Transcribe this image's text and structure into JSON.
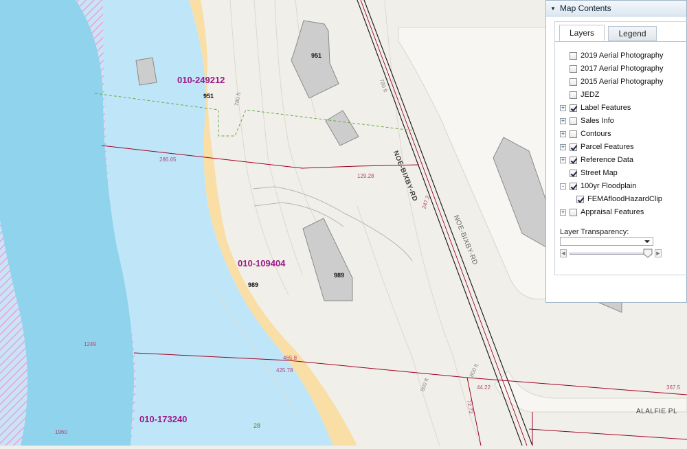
{
  "parcels": [
    {
      "id": "010-249212"
    },
    {
      "id": "010-109404"
    },
    {
      "id": "010-173240"
    }
  ],
  "addresses": [
    "951",
    "951",
    "989",
    "989"
  ],
  "dimensions": [
    "286.65",
    "129.28",
    "247.2",
    "465.8",
    "425.78",
    "44.22",
    "72.73",
    "367.5",
    "1249",
    "1960"
  ],
  "contour_labels": [
    "780 ft",
    "800 ft",
    "800 ft",
    "780 ft"
  ],
  "roads": {
    "main": "NOE-BIXBY-RD",
    "side": "ALALFIE PL"
  },
  "misc_labels": {
    "green_value": "28"
  },
  "panel": {
    "title": "Map Contents",
    "tabs": {
      "layers": "Layers",
      "legend": "Legend"
    },
    "layers": [
      {
        "label": "2019 Aerial Photography",
        "checked": false,
        "expand": false,
        "indent": 1
      },
      {
        "label": "2017 Aerial Photography",
        "checked": false,
        "expand": false,
        "indent": 1
      },
      {
        "label": "2015 Aerial Photography",
        "checked": false,
        "expand": false,
        "indent": 1
      },
      {
        "label": "JEDZ",
        "checked": false,
        "expand": false,
        "indent": 1
      },
      {
        "label": "Label Features",
        "checked": true,
        "expand": "+",
        "indent": 0
      },
      {
        "label": "Sales Info",
        "checked": false,
        "expand": "+",
        "indent": 0
      },
      {
        "label": "Contours",
        "checked": false,
        "expand": "+",
        "indent": 0
      },
      {
        "label": "Parcel Features",
        "checked": true,
        "expand": "+",
        "indent": 0
      },
      {
        "label": "Reference Data",
        "checked": true,
        "expand": "+",
        "indent": 0
      },
      {
        "label": "Street Map",
        "checked": true,
        "expand": false,
        "indent": 1
      },
      {
        "label": "100yr Floodplain",
        "checked": true,
        "expand": "-",
        "indent": 0
      },
      {
        "label": "FEMAfloodHazardClip",
        "checked": true,
        "expand": false,
        "indent": 2
      },
      {
        "label": "Appraisal Features",
        "checked": false,
        "expand": "+",
        "indent": 0
      }
    ],
    "transparency_label": "Layer Transparency:",
    "transparency_value": 0.95
  },
  "colors": {
    "river": "#8fd3ec",
    "water_light": "#bfe6f8",
    "flood_hatch": "#e8a2d8",
    "sand": "#f9dfa5",
    "land": "#f1efe9",
    "building": "#cdcdcd",
    "parcel_line": "#a00020",
    "parcel_label": "#9a1a86"
  }
}
